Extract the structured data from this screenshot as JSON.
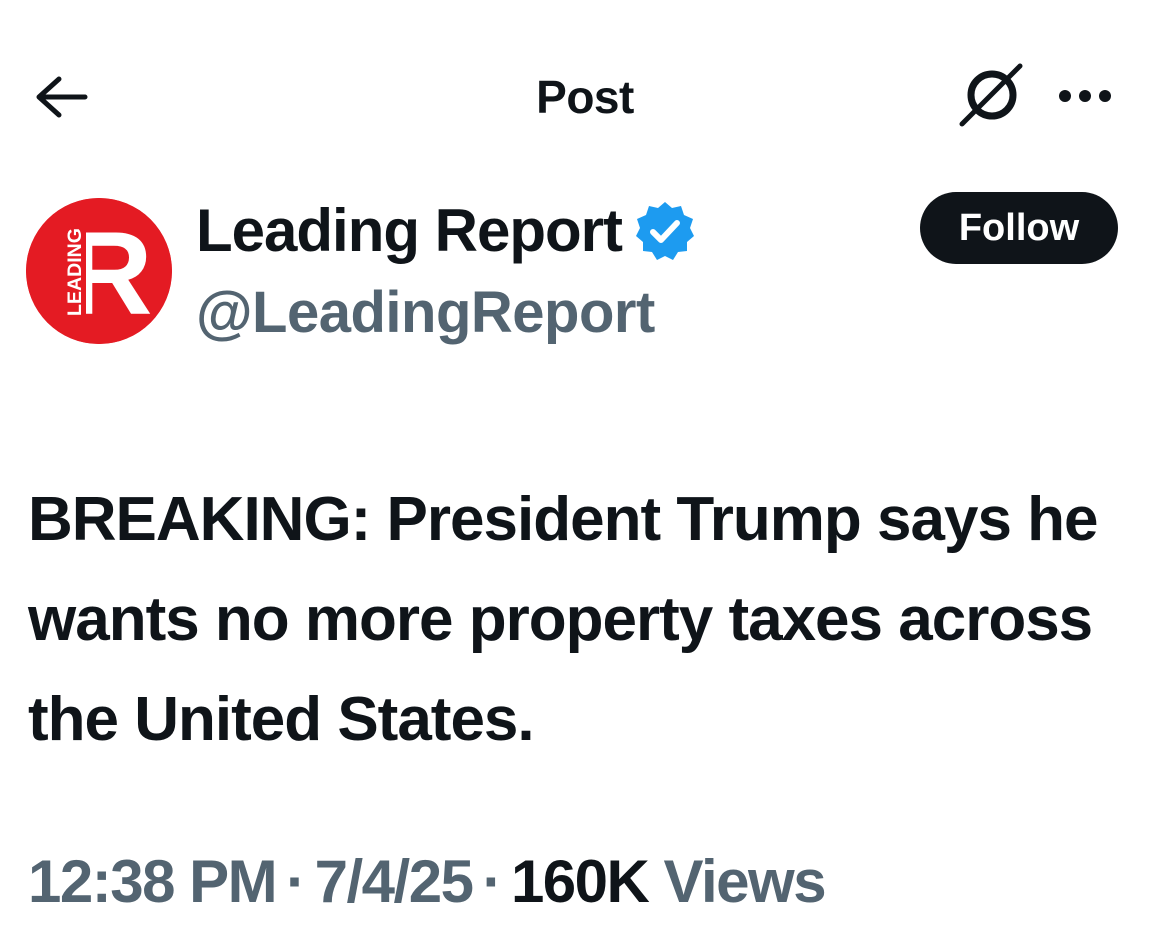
{
  "header": {
    "title": "Post",
    "back_icon": "arrow-left-icon",
    "grok_icon": "grok-icon",
    "more_icon": "more-horizontal-icon"
  },
  "author": {
    "display_name": "Leading Report",
    "handle": "@LeadingReport",
    "verified_icon": "verified-badge-icon",
    "verified_color": "#1d9bf0",
    "avatar_logo_letter": "R",
    "avatar_logo_text": "LEADING",
    "avatar_color": "#e41b23",
    "follow_label": "Follow"
  },
  "post": {
    "text": "BREAKING: President Trump says he wants no more property taxes across the United States."
  },
  "meta": {
    "time": "12:38 PM",
    "date": "7/4/25",
    "separator": "·",
    "views_count": "160K",
    "views_label": "Views"
  }
}
